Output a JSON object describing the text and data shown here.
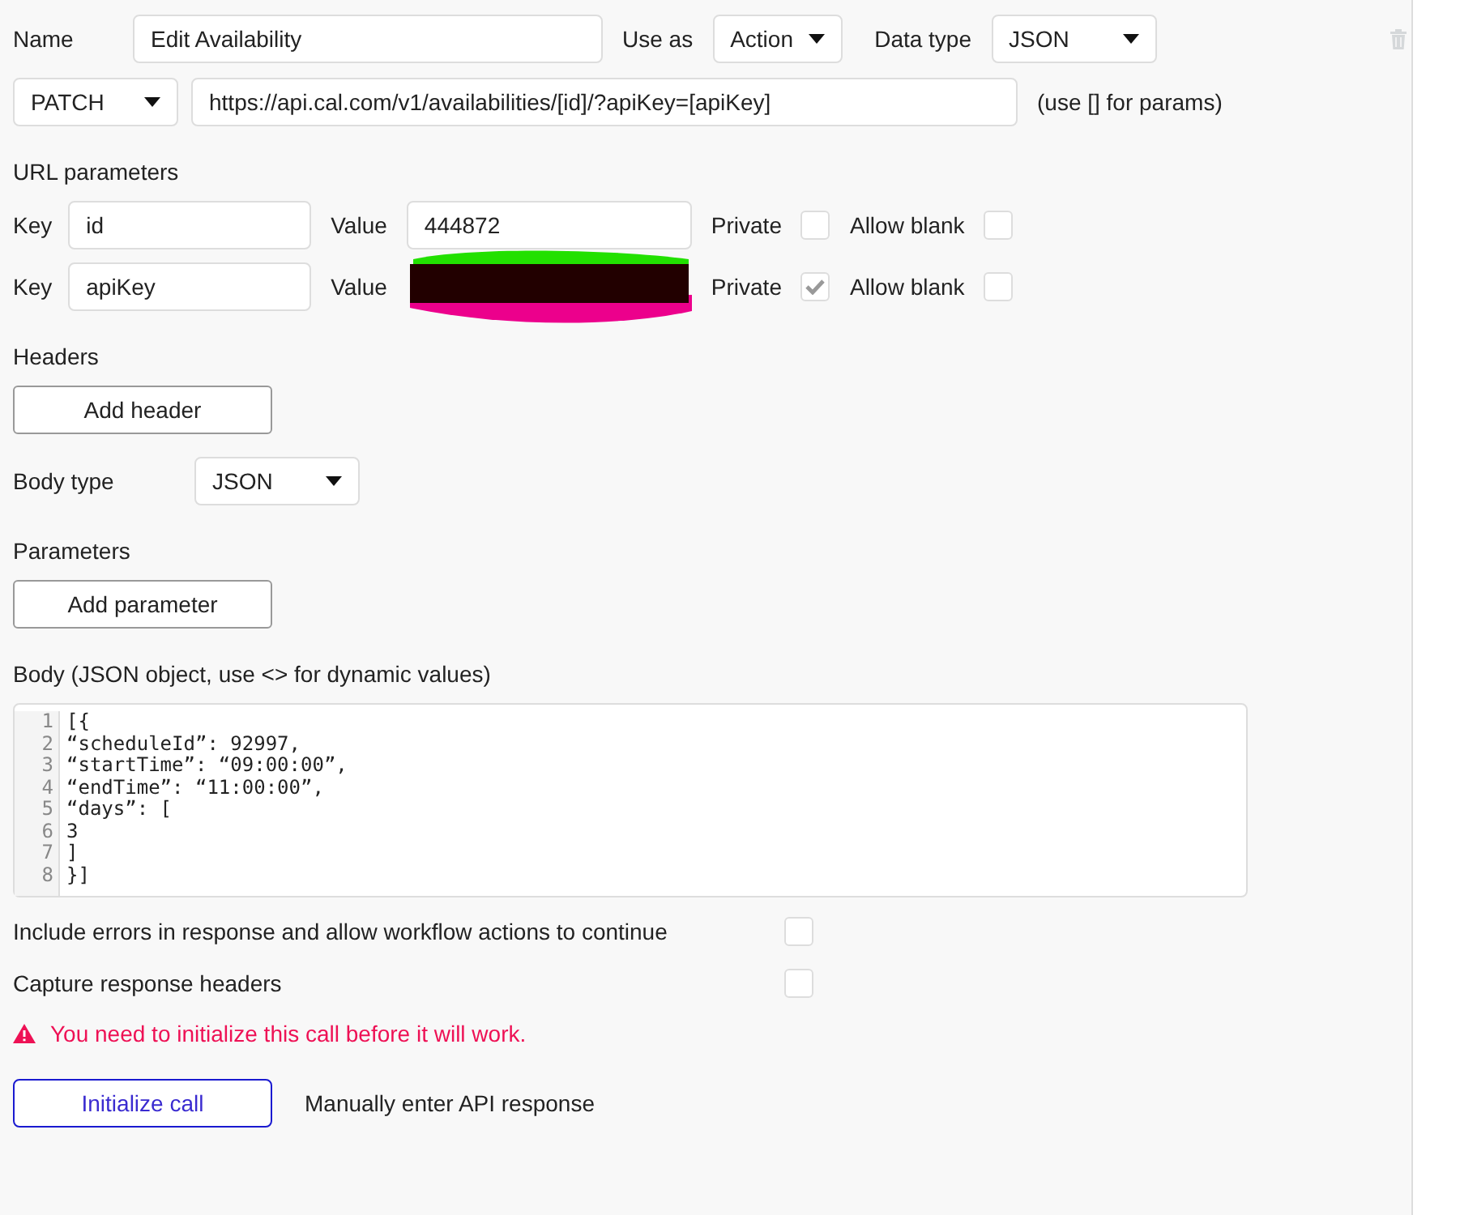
{
  "header": {
    "name_label": "Name",
    "name_value": "Edit Availability",
    "use_as_label": "Use as",
    "use_as_value": "Action",
    "data_type_label": "Data type",
    "data_type_value": "JSON"
  },
  "request": {
    "method": "PATCH",
    "url": "https://api.cal.com/v1/availabilities/[id]/?apiKey=[apiKey]",
    "hint": "(use [] for params)"
  },
  "url_parameters": {
    "title": "URL parameters",
    "items": [
      {
        "key_label": "Key",
        "key": "id",
        "value_label": "Value",
        "value": "444872",
        "redacted": false,
        "private_label": "Private",
        "private": false,
        "allow_blank_label": "Allow blank",
        "allow_blank": false
      },
      {
        "key_label": "Key",
        "key": "apiKey",
        "value_label": "Value",
        "redacted": true,
        "private_label": "Private",
        "private": true,
        "allow_blank_label": "Allow blank",
        "allow_blank": false
      }
    ]
  },
  "headers": {
    "title": "Headers",
    "button": "Add header"
  },
  "body_type": {
    "label": "Body type",
    "value": "JSON"
  },
  "parameters": {
    "title": "Parameters",
    "button": "Add parameter"
  },
  "body": {
    "title": "Body (JSON object, use <> for dynamic values)",
    "lines": [
      "[{",
      "“scheduleId”: 92997,",
      "“startTime”: “09:00:00”,",
      "“endTime”: “11:00:00”,",
      "“days”: [",
      "3",
      "]",
      "}]"
    ],
    "line_numbers": [
      "1",
      "2",
      "3",
      "4",
      "5",
      "6",
      "7",
      "8"
    ]
  },
  "options": [
    {
      "label": "Include errors in response and allow workflow actions to continue",
      "checked": false
    },
    {
      "label": "Capture response headers",
      "checked": false
    }
  ],
  "warning": "You need to initialize this call before it will work.",
  "actions": {
    "initialize": "Initialize call",
    "manual": "Manually enter API response"
  }
}
